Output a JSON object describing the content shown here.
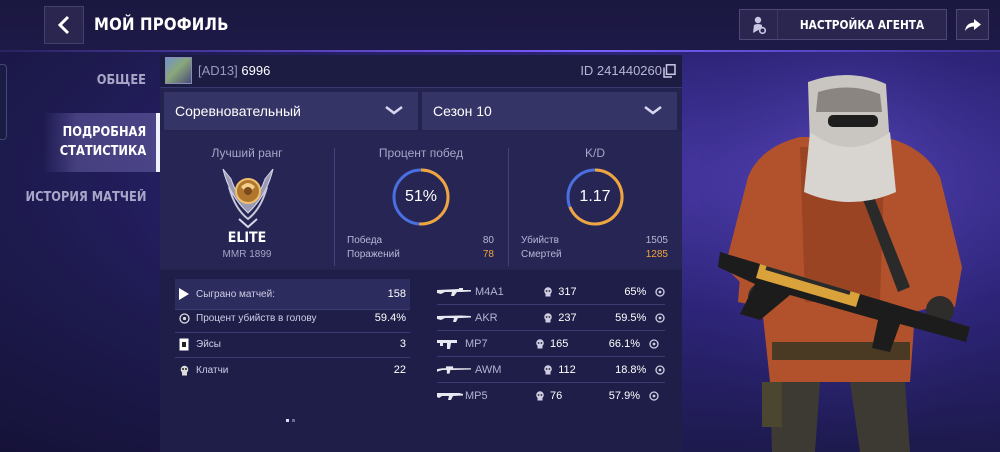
{
  "header": {
    "title": "МОЙ ПРОФИЛЬ",
    "agent_button": "НАСТРОЙКА АГЕНТА"
  },
  "sidebar": {
    "items": [
      {
        "label": "ОБЩЕЕ"
      },
      {
        "label_line1": "ПОДРОБНАЯ",
        "label_line2": "СТАТИСТИКА",
        "active": true
      },
      {
        "label": "ИСТОРИЯ МАТЧЕЙ"
      }
    ]
  },
  "player": {
    "clan_tag": "[AD13]",
    "name": "6996",
    "id": "ID 241440260"
  },
  "filters": {
    "mode": "Соревновательный",
    "season": "Сезон 10"
  },
  "summary": {
    "rank": {
      "title": "Лучший ранг",
      "name": "ELITE",
      "mmr": "MMR 1899"
    },
    "winrate": {
      "title": "Процент побед",
      "value": "51%",
      "fraction": 0.51,
      "rows": [
        {
          "label": "Победа",
          "value": "80"
        },
        {
          "label": "Поражений",
          "value": "78"
        }
      ]
    },
    "kd": {
      "title": "K/D",
      "value": "1.17",
      "rows": [
        {
          "label": "Убийств",
          "value": "1505"
        },
        {
          "label": "Смертей",
          "value": "1285"
        }
      ]
    }
  },
  "general_stats": [
    {
      "icon": "play-icon",
      "label": "Сыграно матчей:",
      "value": "158"
    },
    {
      "icon": "headshot-icon",
      "label": "Процент убийств в голову",
      "value": "59.4%"
    },
    {
      "icon": "aces-icon",
      "label": "Эйсы",
      "value": "3"
    },
    {
      "icon": "clutch-icon",
      "label": "Клатчи",
      "value": "22"
    }
  ],
  "weapons": [
    {
      "name": "M4A1",
      "kills": "317",
      "hs_pct": "65%"
    },
    {
      "name": "AKR",
      "kills": "237",
      "hs_pct": "59.5%"
    },
    {
      "name": "MP7",
      "kills": "165",
      "hs_pct": "66.1%"
    },
    {
      "name": "AWM",
      "kills": "112",
      "hs_pct": "18.8%"
    },
    {
      "name": "MP5",
      "kills": "76",
      "hs_pct": "57.9%"
    }
  ],
  "pager": {
    "pages": 2,
    "current": 1
  },
  "colors": {
    "accent_orange": "#f0a43c",
    "ring_blue": "#4a6fe0",
    "bg": "#1d1a4e"
  }
}
